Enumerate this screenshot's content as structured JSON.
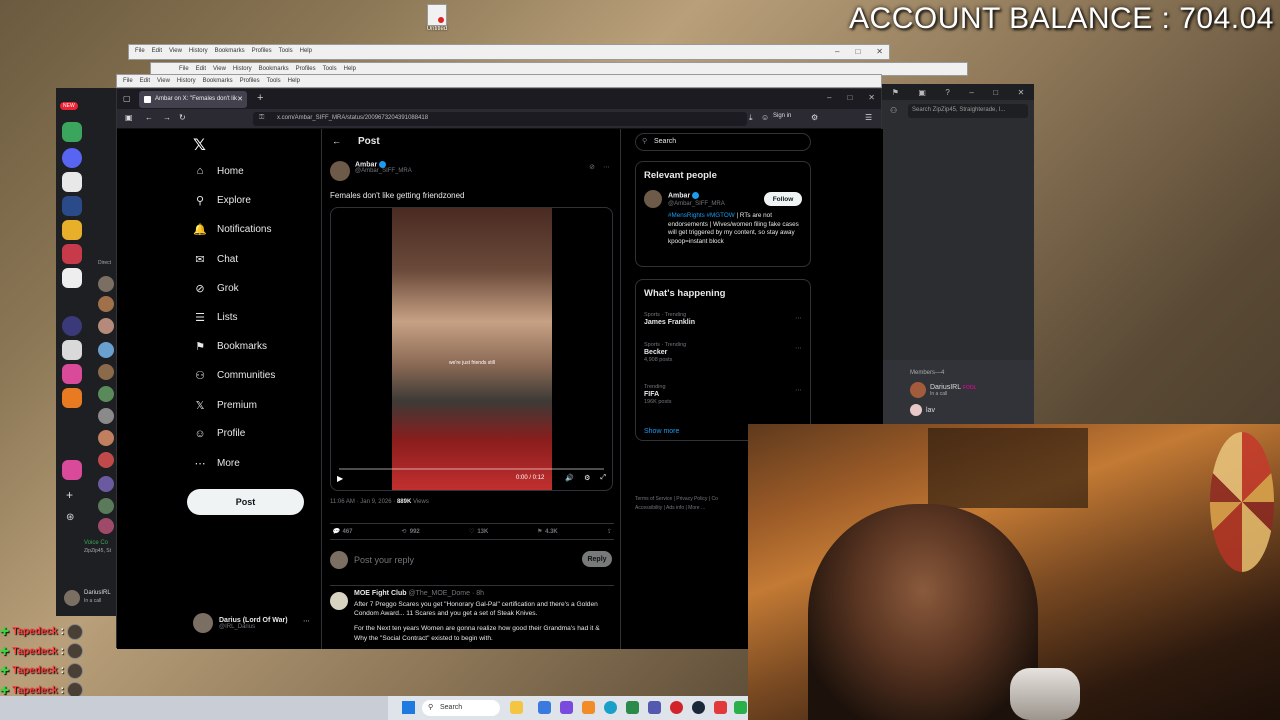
{
  "overlay": {
    "balance": "ACCOUNT BALANCE : 704.04",
    "desktop_icon_label": "Untitled"
  },
  "bg_windows": {
    "menu": [
      "File",
      "Edit",
      "View",
      "History",
      "Bookmarks",
      "Profiles",
      "Tools",
      "Help"
    ]
  },
  "browser": {
    "tab_title": "Ambar on X: \"Females don't lik",
    "url": "x.com/Ambar_SIFF_MRA/status/2009673204391088418",
    "sign_in": "Sign in"
  },
  "x_nav": {
    "items": [
      {
        "label": "Home",
        "icon": "home-icon",
        "glyph": "⌂"
      },
      {
        "label": "Explore",
        "icon": "search-icon",
        "glyph": "⚲"
      },
      {
        "label": "Notifications",
        "icon": "bell-icon",
        "glyph": "🔔"
      },
      {
        "label": "Chat",
        "icon": "mail-icon",
        "glyph": "✉"
      },
      {
        "label": "Grok",
        "icon": "grok-icon",
        "glyph": "⊘"
      },
      {
        "label": "Lists",
        "icon": "list-icon",
        "glyph": "☰"
      },
      {
        "label": "Bookmarks",
        "icon": "bookmark-icon",
        "glyph": "⚑"
      },
      {
        "label": "Communities",
        "icon": "people-icon",
        "glyph": "⚇"
      },
      {
        "label": "Premium",
        "icon": "x-icon",
        "glyph": "𝕏"
      },
      {
        "label": "Profile",
        "icon": "person-icon",
        "glyph": "☺"
      },
      {
        "label": "More",
        "icon": "more-icon",
        "glyph": "⋯"
      }
    ],
    "post_button": "Post",
    "account_name": "Darius (Lord Of War)",
    "account_handle": "@IRL_Darius"
  },
  "post": {
    "header": "Post",
    "author_name": "Ambar",
    "author_handle": "@Ambar_SIFF_MRA",
    "text": "Females don't like getting friendzoned",
    "video_caption": "we're just friends still",
    "video_time": "0:00 / 0:12",
    "time": "11:06 AM · Jan 9, 2026 · ",
    "views_count": "889K",
    "views_label": " Views",
    "replies": "467",
    "reposts": "992",
    "likes": "13K",
    "bookmarks": "4.3K",
    "reply_placeholder": "Post your reply",
    "reply_button": "Reply"
  },
  "reply_tweet": {
    "author": "MOE Fight Club",
    "handle": "@The_MOE_Dome · 8h",
    "text1": "After 7 Preggo Scares you get \"Honorary Gal-Pal\" certification and there's a Golden Condom Award... 11 Scares and you get a set of Steak Knives.",
    "text2": "For the Next ten years Women are gonna realize how good their Grandma's had it & Why the \"Social Contract\" existed to begin with."
  },
  "sidebar": {
    "search_placeholder": "Search",
    "relevant_title": "Relevant people",
    "rp_name": "Ambar",
    "rp_handle": "@Ambar_SIFF_MRA",
    "rp_follow": "Follow",
    "rp_bio_tags": "#MensRights #MGTOW",
    "rp_bio_text": " | RTs are not endorsements | Wives/women filing fake cases will get triggered by my content, so stay away kpoop=instant block",
    "happening_title": "What's happening",
    "trends": [
      {
        "category": "Sports · Trending",
        "name": "James Franklin",
        "count": ""
      },
      {
        "category": "Sports · Trending",
        "name": "Becker",
        "count": "4,908 posts"
      },
      {
        "category": "Trending",
        "name": "FIFA",
        "count": "196K posts"
      }
    ],
    "show_more": "Show more",
    "footer": "Terms of Service | Privacy Policy | Co Accessibility | Ads info | More ..."
  },
  "discord": {
    "search": "Search ZipZip45, Straighterade, I...",
    "members_header": "Members—4",
    "member1": "DariusIRL",
    "member1_badge": "FOOL",
    "member1_sub": "In a call",
    "member2": "lav",
    "voice_label": "Voice Co",
    "voice_sub": "ZipZip45, St",
    "user": "DariusIRL",
    "user_sub": "In a call",
    "new_badge": "NEW",
    "dm_label": "Direct"
  },
  "chat": {
    "lines": [
      "Tapedeck",
      "Tapedeck",
      "Tapedeck",
      "Tapedeck",
      "Tapedeck"
    ]
  },
  "taskbar": {
    "search": "Search"
  }
}
